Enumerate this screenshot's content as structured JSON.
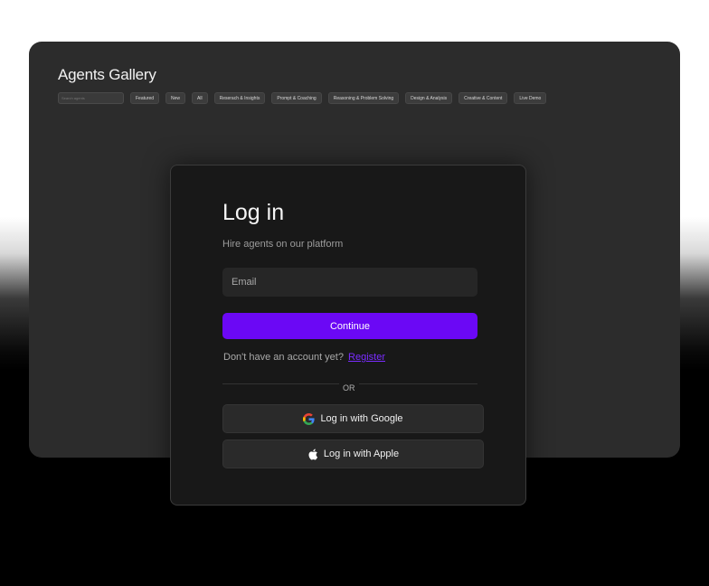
{
  "gallery": {
    "title": "Agents Gallery",
    "search_placeholder": "Search agents",
    "filters": [
      "Featured",
      "New",
      "All",
      "Reserach & Insights",
      "Prompt & Coaching",
      "Reasoning & Problem Solving",
      "Design & Analysis",
      "Creative & Content",
      "Live Demo"
    ]
  },
  "login": {
    "title": "Log in",
    "subtitle": "Hire agents on our platform",
    "email_placeholder": "Email",
    "continue_label": "Continue",
    "no_account_text": "Don't have an account yet?",
    "register_label": "Register",
    "or_label": "OR",
    "google_label": "Log in with Google",
    "apple_label": "Log in with Apple",
    "accent_color": "#6b08f5"
  },
  "icons": {
    "google": "google-icon",
    "apple": "apple-icon"
  }
}
